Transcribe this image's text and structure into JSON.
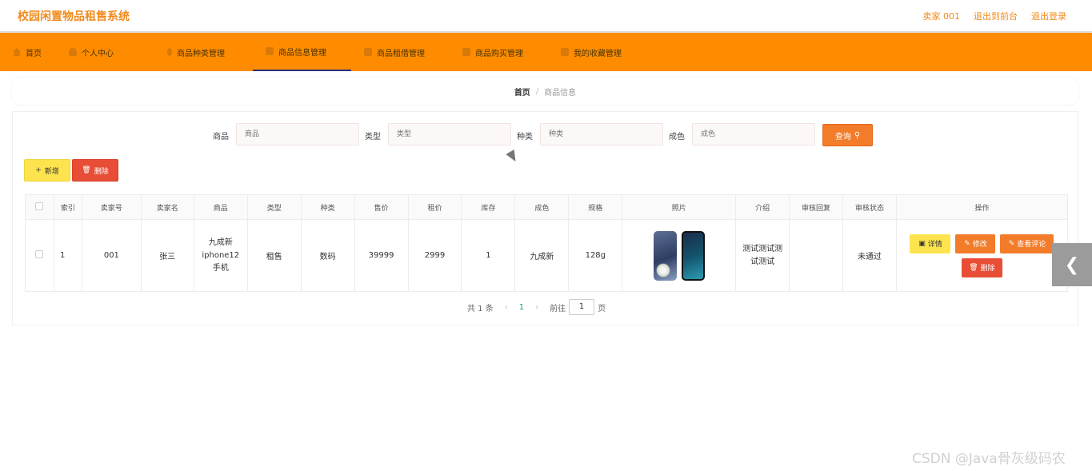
{
  "header": {
    "title": "校园闲置物品租售系统",
    "links": [
      "卖家 001",
      "退出到前台",
      "退出登录"
    ]
  },
  "nav": {
    "items": [
      "首页",
      "个人中心",
      "商品种类管理",
      "商品信息管理",
      "商品租借管理",
      "商品购买管理",
      "我的收藏管理"
    ],
    "active_index": 3
  },
  "breadcrumb": {
    "home": "首页",
    "separator": "/",
    "current": "商品信息"
  },
  "search": {
    "fields": [
      {
        "label": "商品",
        "placeholder": "商品"
      },
      {
        "label": "类型",
        "placeholder": "类型"
      },
      {
        "label": "种类",
        "placeholder": "种类"
      },
      {
        "label": "成色",
        "placeholder": "成色"
      }
    ],
    "query_label": "查询"
  },
  "actions": {
    "add_label": "新增",
    "delete_label": "删除"
  },
  "table": {
    "columns": [
      "索引",
      "卖家号",
      "卖家名",
      "商品",
      "类型",
      "种类",
      "售价",
      "租价",
      "库存",
      "成色",
      "规格",
      "照片",
      "介绍",
      "审核回复",
      "审核状态",
      "操作"
    ],
    "rows": [
      {
        "index": "1",
        "seller_no": "001",
        "seller_name": "张三",
        "product": "九成新iphone12手机",
        "type": "租售",
        "category": "数码",
        "price": "39999",
        "rent": "2999",
        "stock": "1",
        "condition": "九成新",
        "spec": "128g",
        "intro": "测试测试测试测试",
        "review_reply": "",
        "review_status": "未通过",
        "ops": {
          "detail": "详情",
          "edit": "修改",
          "review": "查看评论",
          "remove": "删除"
        }
      }
    ]
  },
  "pagination": {
    "total": "共 1 条",
    "current_page": "1",
    "goto_label": "前往",
    "goto_value": "1",
    "page_suffix": "页"
  },
  "watermark": "CSDN @Java骨灰级码农",
  "colors": {
    "nav_bg": "#ff8c00",
    "accent": "#f27c2a",
    "danger": "#e84d35",
    "warning": "#fde44f"
  }
}
